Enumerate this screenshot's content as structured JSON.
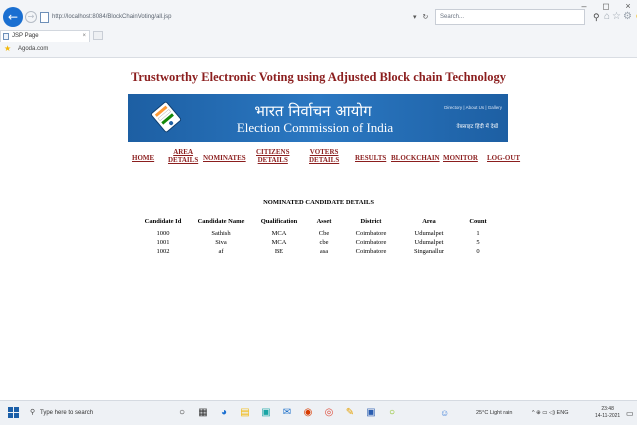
{
  "browser": {
    "address": "http://localhost:8084/BlockChainVoting/all.jsp",
    "search_placeholder": "Search...",
    "tab_title": "JSP Page",
    "tab_close": "×",
    "favorite": "Agoda.com",
    "window_controls": [
      "–",
      "◻",
      "×"
    ]
  },
  "page": {
    "site_title": "Trustworthy Electronic Voting using Adjusted Block chain Technology",
    "banner": {
      "hindi_title": "भारत निर्वाचन आयोग",
      "english_title": "Election Commission of India",
      "top_links": "Directory  |  About Us  |  Gallery",
      "sub_link": "वेबसाइट हिंदी में देखें"
    },
    "nav": {
      "home": "HOME",
      "area_details": "AREA\nDETAILS",
      "nominates": "NOMINATES",
      "citizens_details": "CITIZENS\nDETAILS",
      "voters_details": "VOTERS\nDETAILS",
      "results": "RESULTS",
      "blockchain": "BLOCKCHAIN",
      "monitor": "MONITOR",
      "logout": "LOG-OUT"
    },
    "section_title": "NOMINATED CANDIDATE DETAILS",
    "table": {
      "headers": [
        "Candidate Id",
        "Candidate Name",
        "Qualification",
        "Asset",
        "District",
        "Area",
        "Count"
      ],
      "rows": [
        [
          "1000",
          "Sathish",
          "MCA",
          "Cbe",
          "Coimbatore",
          "Udumalpet",
          "1"
        ],
        [
          "1001",
          "Siva",
          "MCA",
          "cbe",
          "Coimbatore",
          "Udumalpet",
          "5"
        ],
        [
          "1002",
          "af",
          "BE",
          "asa",
          "Coimbatore",
          "Singanallur",
          "0"
        ]
      ]
    }
  },
  "taskbar": {
    "search_placeholder": "Type here to search",
    "weather": "25°C  Light rain",
    "tray_icons": "^  ⊕  ▭  ◁)  ENG",
    "time": "23:48",
    "date": "14-11-2021"
  }
}
